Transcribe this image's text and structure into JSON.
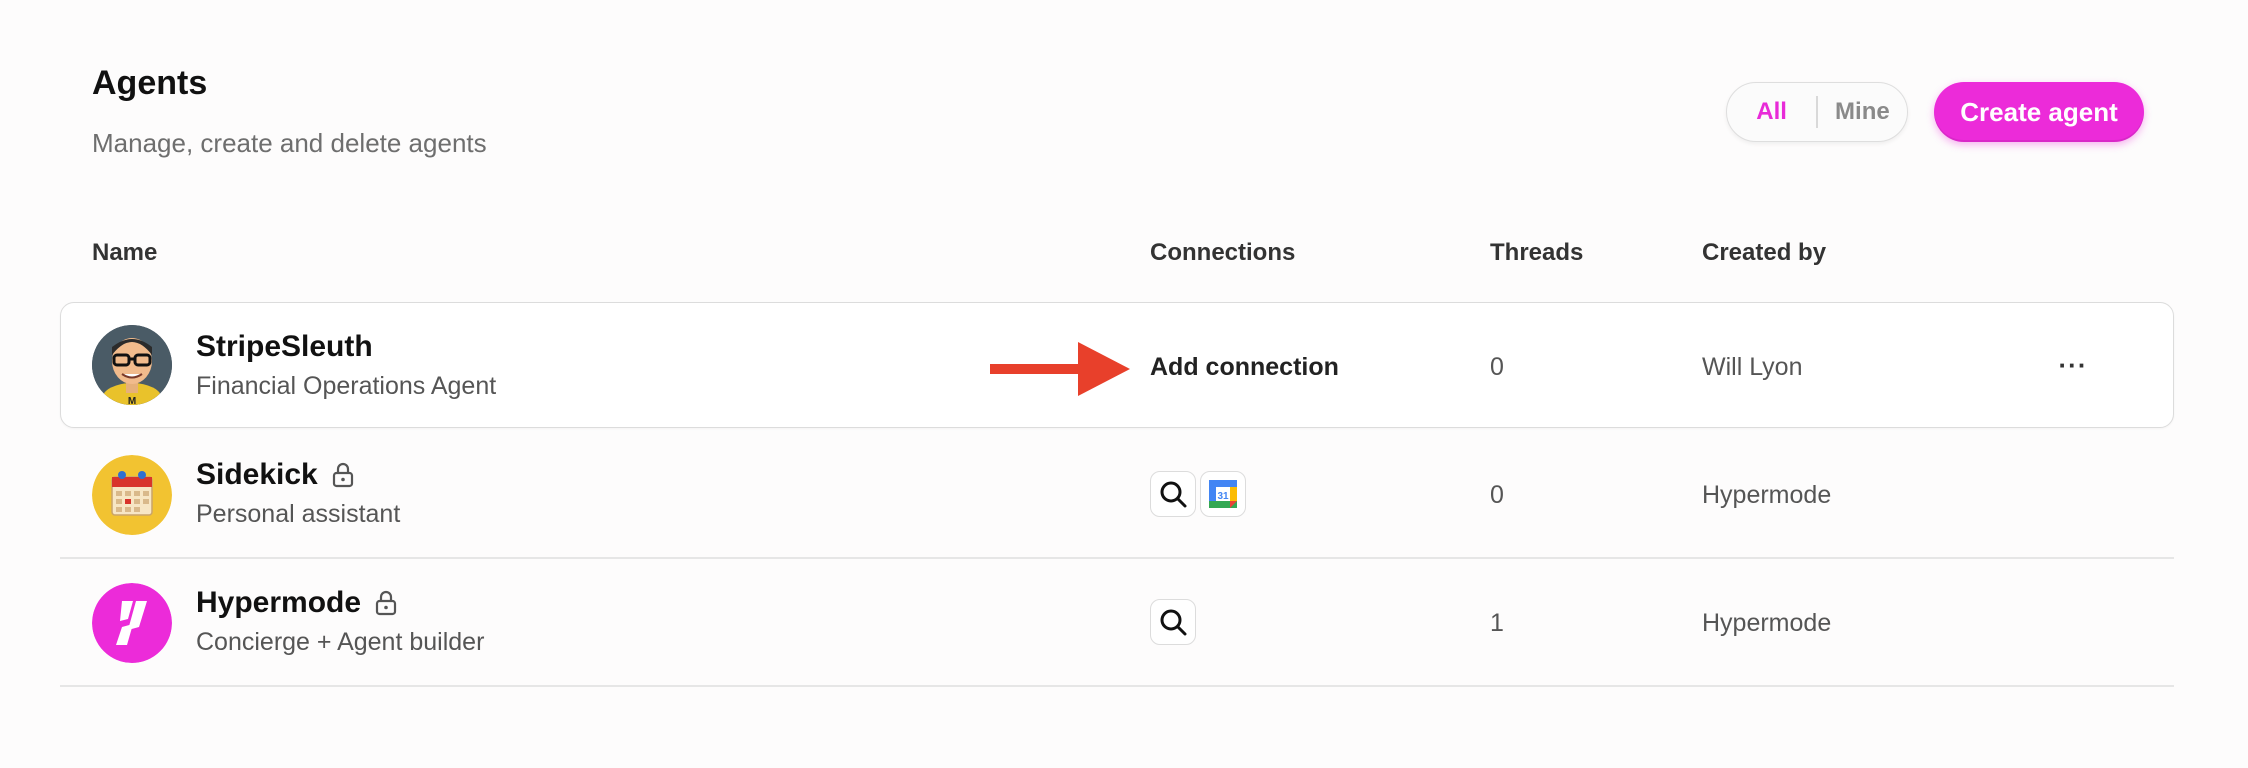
{
  "header": {
    "title": "Agents",
    "subtitle": "Manage, create and delete agents",
    "filter": {
      "options": [
        "All",
        "Mine"
      ],
      "selected": "All"
    },
    "create_label": "Create agent"
  },
  "table": {
    "columns": [
      "Name",
      "Connections",
      "Threads",
      "Created by"
    ],
    "rows": [
      {
        "name": "StripeSleuth",
        "description": "Financial Operations Agent",
        "connection_action": "Add connection",
        "connections": [],
        "threads": "0",
        "created_by": "Will Lyon",
        "locked": false,
        "more": "···"
      },
      {
        "name": "Sidekick",
        "description": "Personal assistant",
        "connections": [
          "search-icon",
          "google-calendar-icon"
        ],
        "calendar_day": "31",
        "threads": "0",
        "created_by": "Hypermode",
        "locked": true
      },
      {
        "name": "Hypermode",
        "description": "Concierge + Agent builder",
        "connections": [
          "search-icon"
        ],
        "threads": "1",
        "created_by": "Hypermode",
        "locked": true
      }
    ]
  },
  "colors": {
    "accent": "#ec2bd9",
    "arrow": "#e8402b"
  }
}
